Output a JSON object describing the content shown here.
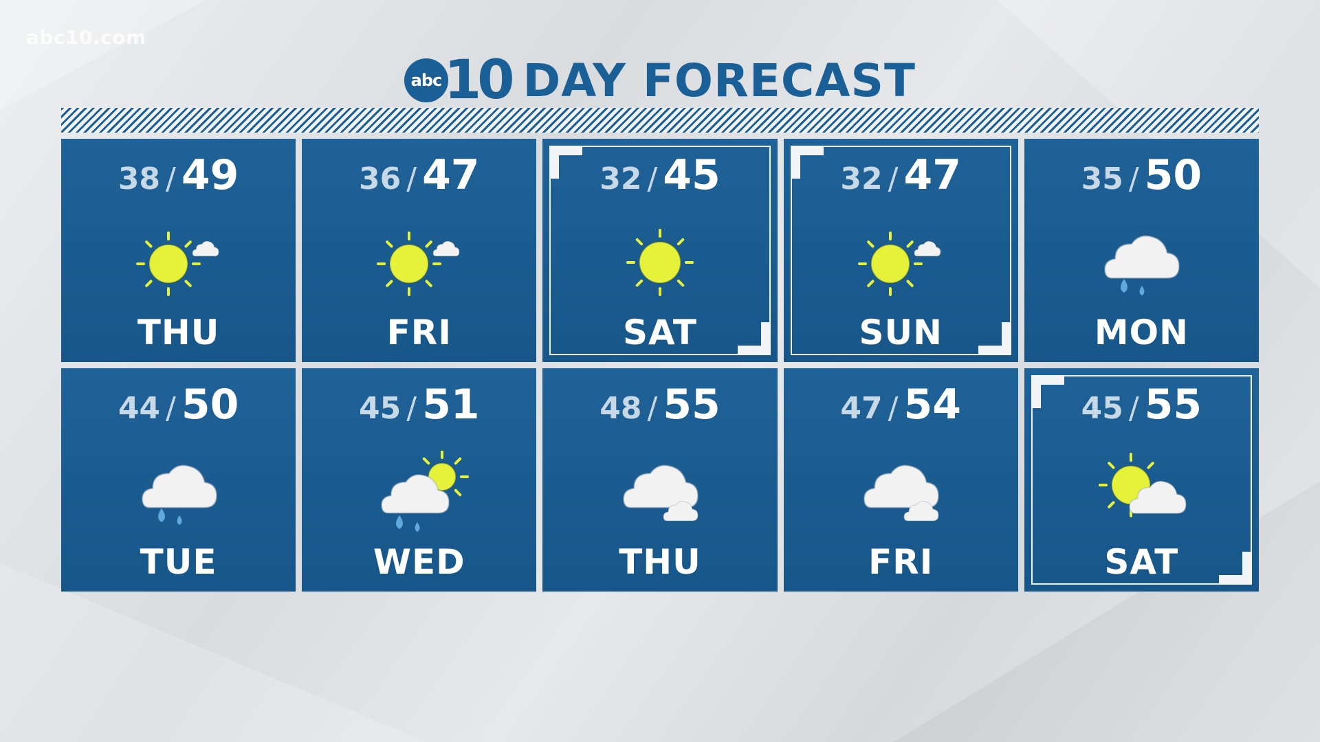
{
  "watermark": "abc10.com",
  "header": {
    "logo_circle": "abc",
    "logo_number": "10",
    "title": "DAY FORECAST"
  },
  "colors": {
    "tile": "#1b5c92",
    "brand": "#1b5f97",
    "sun": "#e6f23a",
    "rain": "#5fa8e0",
    "cloud": "#f2f2f2"
  },
  "days": [
    {
      "lo": "38",
      "hi": "49",
      "day": "THU",
      "icon": "sun-small-cloud-icon",
      "weekend": false
    },
    {
      "lo": "36",
      "hi": "47",
      "day": "FRI",
      "icon": "sun-small-cloud-icon",
      "weekend": false
    },
    {
      "lo": "32",
      "hi": "45",
      "day": "SAT",
      "icon": "sunny-icon",
      "weekend": true
    },
    {
      "lo": "32",
      "hi": "47",
      "day": "SUN",
      "icon": "sun-small-cloud-icon",
      "weekend": true
    },
    {
      "lo": "35",
      "hi": "50",
      "day": "MON",
      "icon": "cloud-rain-icon",
      "weekend": false
    },
    {
      "lo": "44",
      "hi": "50",
      "day": "TUE",
      "icon": "cloud-rain-icon",
      "weekend": false
    },
    {
      "lo": "45",
      "hi": "51",
      "day": "WED",
      "icon": "sun-cloud-rain-icon",
      "weekend": false
    },
    {
      "lo": "48",
      "hi": "55",
      "day": "THU",
      "icon": "cloudy-icon",
      "weekend": false
    },
    {
      "lo": "47",
      "hi": "54",
      "day": "FRI",
      "icon": "cloudy-icon",
      "weekend": false
    },
    {
      "lo": "45",
      "hi": "55",
      "day": "SAT",
      "icon": "partly-cloudy-icon",
      "weekend": true
    }
  ]
}
